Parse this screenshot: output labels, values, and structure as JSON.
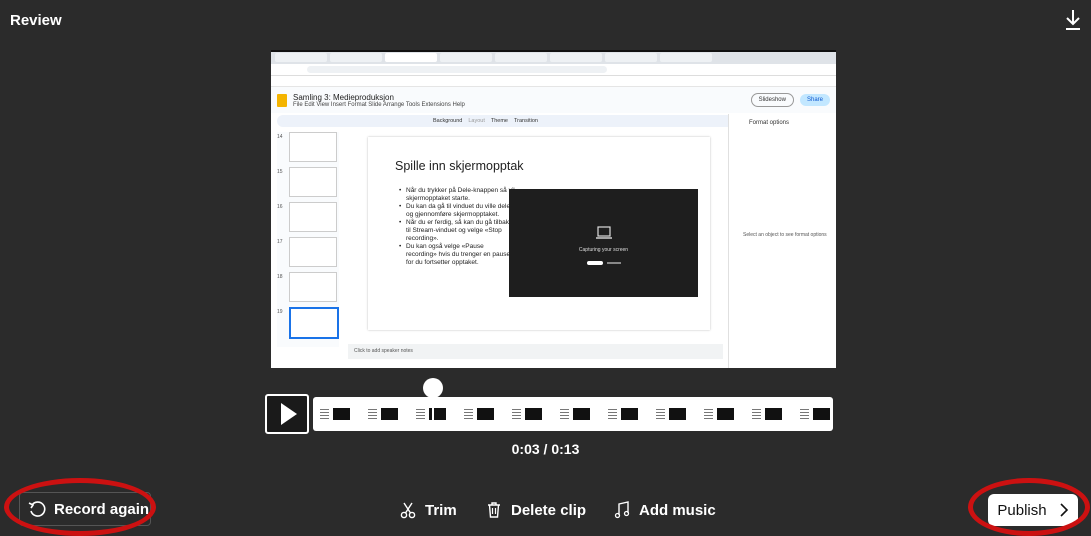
{
  "header": {
    "title": "Review",
    "download_icon": "download-icon"
  },
  "preview": {
    "doc_title": "Samling 3: Medieproduksjon",
    "doc_menu": "File  Edit  View  Insert  Format  Slide  Arrange  Tools  Extensions  Help",
    "slideshow_label": "Slideshow",
    "share_label": "Share",
    "toolbar_items": [
      "Background",
      "Layout",
      "Theme",
      "Transition"
    ],
    "thumb_numbers": [
      "14",
      "15",
      "16",
      "17",
      "18",
      "19"
    ],
    "slide": {
      "title": "Spille inn skjermopptak",
      "bullets": [
        "Når du trykker på Dele-knappen så vil skjermopptaket starte.",
        "Du kan da gå til vinduet du ville dele og gjennomføre skjermopptaket.",
        "Når du er ferdig, så kan du gå tilbake til Stream-vinduet og velge «Stop recording».",
        "Du kan også velge «Pause recording» hvis du trenger en pause for du fortsetter opptaket."
      ],
      "capture_text": "Capturing your screen"
    },
    "format_panel_title": "Format options",
    "format_panel_hint": "Select an object to see format options",
    "speaker_notes": "Click to add speaker notes"
  },
  "player": {
    "time": "0:03 / 0:13",
    "progress_fraction": 0.23
  },
  "actions": {
    "record_again": "Record again",
    "trim": "Trim",
    "delete_clip": "Delete clip",
    "add_music": "Add music",
    "publish": "Publish"
  },
  "colors": {
    "background": "#2b2b2b",
    "annotation_ring": "#cc1111",
    "publish_bg": "#ffffff"
  }
}
